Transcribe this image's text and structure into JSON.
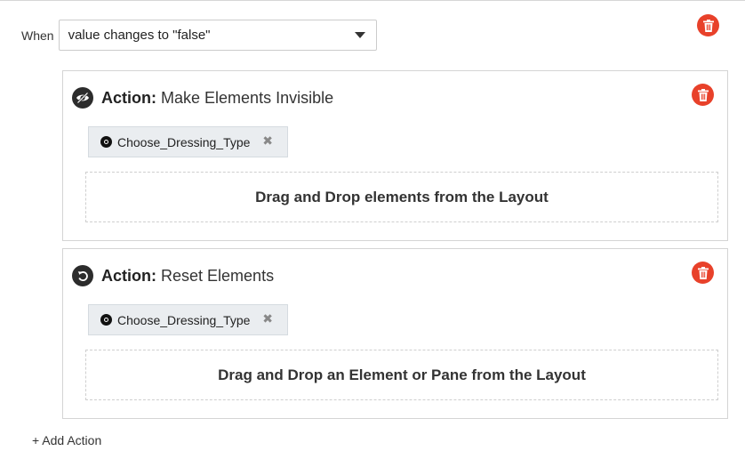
{
  "trigger": {
    "when_label": "When",
    "condition_value": "value changes to \"false\""
  },
  "actions": [
    {
      "prefix": "Action:",
      "name": "Make Elements Invisible",
      "icon": "eye-slash-icon",
      "element_chip": "Choose_Dressing_Type",
      "dropzone_text": "Drag and Drop elements from the Layout"
    },
    {
      "prefix": "Action:",
      "name": "Reset Elements",
      "icon": "undo-icon",
      "element_chip": "Choose_Dressing_Type",
      "dropzone_text": "Drag and Drop an Element or Pane from the Layout"
    }
  ],
  "footer": {
    "add_action_label": "+ Add Action"
  },
  "colors": {
    "delete_accent": "#e8412a",
    "chip_bg": "#eaedf0",
    "border": "#d4d4d4"
  }
}
